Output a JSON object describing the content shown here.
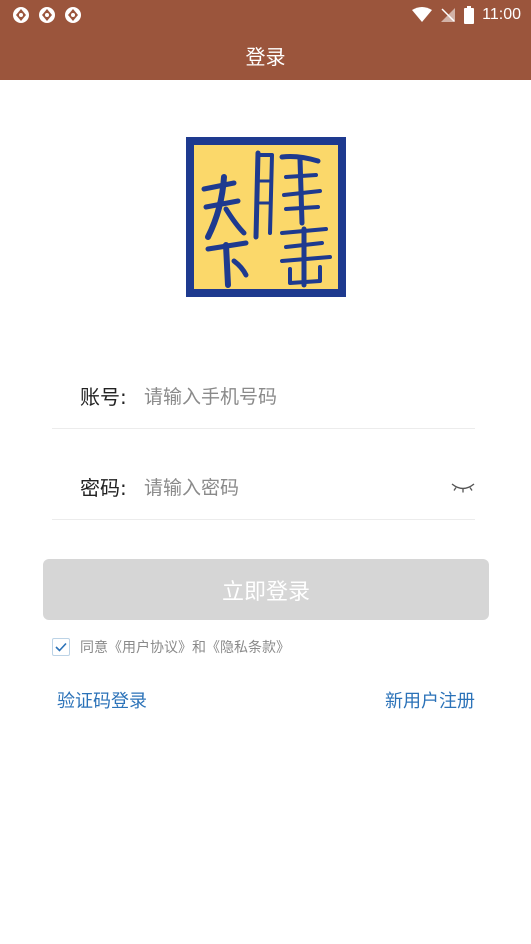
{
  "status_bar": {
    "time": "11:00",
    "icons": [
      "notification-icon",
      "notification-icon",
      "notification-icon",
      "wifi-icon",
      "signal-icon",
      "battery-icon"
    ]
  },
  "header": {
    "title": "登录"
  },
  "logo": {
    "text": "天下膳善",
    "colors": {
      "border": "#1e3a8f",
      "fill": "#fbd86a"
    }
  },
  "form": {
    "account_label": "账号:",
    "account_placeholder": "请输入手机号码",
    "password_label": "密码:",
    "password_placeholder": "请输入密码"
  },
  "login_button": {
    "label": "立即登录"
  },
  "agreement": {
    "text": "同意《用户协议》和《隐私条款》",
    "checked": true
  },
  "links": {
    "sms_login": "验证码登录",
    "register": "新用户注册"
  },
  "colors": {
    "header_bg": "#9b553c",
    "link": "#2b72b8",
    "button_disabled": "#d6d6d6"
  }
}
